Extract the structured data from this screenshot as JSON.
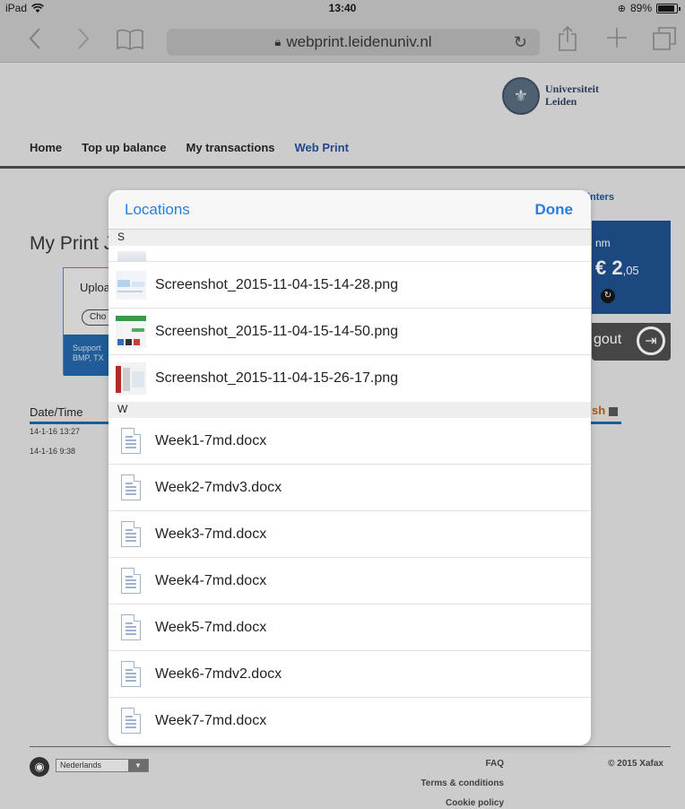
{
  "statusbar": {
    "device": "iPad",
    "time": "13:40",
    "battery": "89%",
    "battery_level": 0.89
  },
  "browser": {
    "url": "webprint.leidenuniv.nl",
    "icons": [
      "back-icon",
      "forward-icon",
      "bookmarks-icon",
      "lock-icon",
      "reload-icon",
      "share-icon",
      "new-tab-icon",
      "tabs-icon"
    ]
  },
  "site": {
    "logo_line1": "Universiteit",
    "logo_line2": "Leiden",
    "nav": [
      "Home",
      "Top up balance",
      "My transactions",
      "Web Print"
    ],
    "side_link": "inters",
    "page_title": "My Print J",
    "upload_label": "Uploa",
    "choose_label": "Cho",
    "upload_info_1": "Support",
    "upload_info_2": "BMP, TX",
    "balance_header": "nm",
    "balance_currency": "€ 2",
    "balance_cents": ",05",
    "logout_label": "gout",
    "date_col": "Date/Time",
    "refresh_label": "sh",
    "rows": [
      "14-1-16 13:27",
      "14-1-16 9:38"
    ],
    "language": "Nederlands",
    "faq": "FAQ",
    "terms": "Terms & conditions",
    "cookie": "Cookie policy",
    "copyright": "© 2015 Xafax",
    "brand_color": "#1f4d99"
  },
  "sheet": {
    "title": "Locations",
    "done": "Done",
    "accent": "#2a7de0",
    "section_s": "S",
    "section_w": "W",
    "images": [
      "Screenshot_2015-11-04-15-14-28.png",
      "Screenshot_2015-11-04-15-14-50.png",
      "Screenshot_2015-11-04-15-26-17.png"
    ],
    "docs": [
      "Week1-7md.docx",
      "Week2-7mdv3.docx",
      "Week3-7md.docx",
      "Week4-7md.docx",
      "Week5-7md.docx",
      "Week6-7mdv2.docx",
      "Week7-7md.docx"
    ]
  }
}
